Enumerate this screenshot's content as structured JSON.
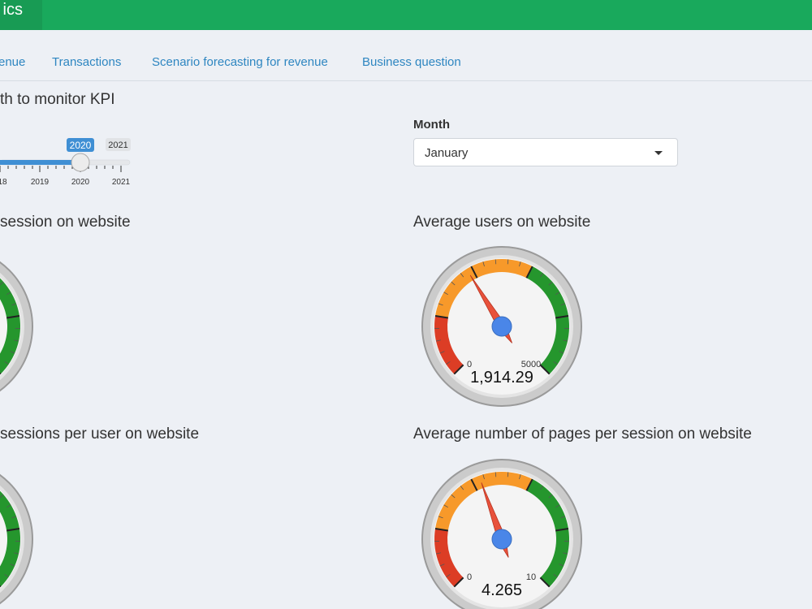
{
  "navbar": {
    "title": "ics",
    "color": "#19a95c"
  },
  "tabs": [
    {
      "label": "enue"
    },
    {
      "label": "Transactions"
    },
    {
      "label": "Scenario forecasting for revenue"
    },
    {
      "label": "Business question"
    }
  ],
  "year_filter": {
    "heading": "th to monitor KPI",
    "value": "2020",
    "max_label": "2021",
    "ticks": [
      "18",
      "2019",
      "2020",
      "2021"
    ]
  },
  "month_filter": {
    "label": "Month",
    "value": "January"
  },
  "gauges": {
    "sessions": {
      "title": "session on website"
    },
    "users": {
      "title": "Average users on website",
      "value": 1914.29,
      "display": "1,914.29",
      "min": "0",
      "max": "5000"
    },
    "sessions_per_user": {
      "title": "sessions per user on website"
    },
    "pages": {
      "title": "Average number of pages per session on website",
      "value": 4.265,
      "display": "4.265",
      "min": "0",
      "max": "10"
    }
  },
  "colors": {
    "red": "#dc3d25",
    "orange": "#f7992a",
    "green": "#25962d",
    "needle": "#e8513b",
    "hub": "#4a86e8",
    "link": "#2e86c1",
    "slider": "#3f8fd4"
  }
}
